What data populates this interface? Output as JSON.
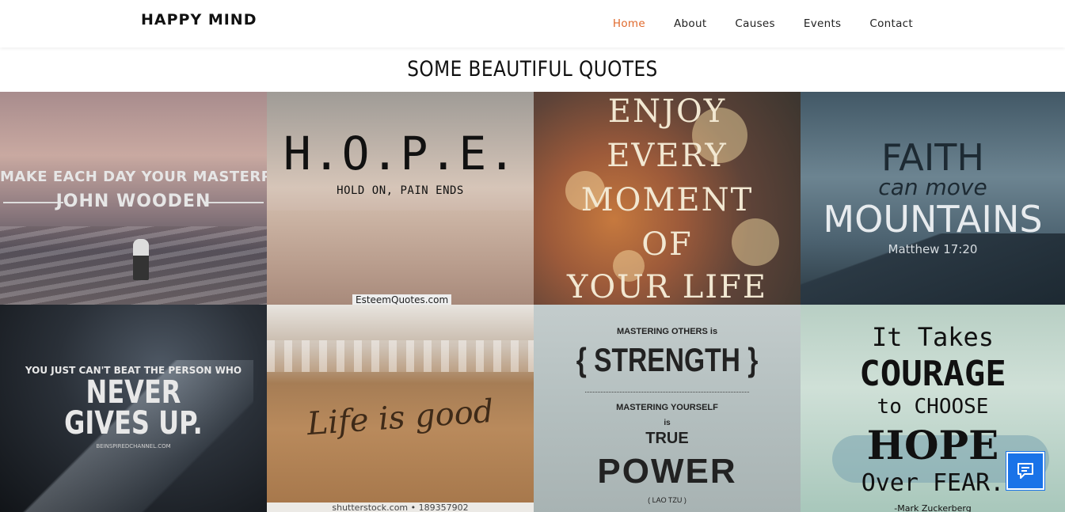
{
  "header": {
    "brand": "HAPPY MIND",
    "nav": [
      {
        "label": "Home",
        "active": true
      },
      {
        "label": "About",
        "active": false
      },
      {
        "label": "Causes",
        "active": false
      },
      {
        "label": "Events",
        "active": false
      },
      {
        "label": "Contact",
        "active": false
      }
    ],
    "accent_color": "#e0692c"
  },
  "main": {
    "title": "SOME BEAUTIFUL QUOTES",
    "quotes": [
      {
        "lines": [
          "MAKE EACH DAY YOUR MASTERPIECE",
          "JOHN WOODEN"
        ]
      },
      {
        "lines": [
          "H.O.P.E.",
          "HOLD ON, PAIN ENDS"
        ],
        "source": "EsteemQuotes.com"
      },
      {
        "lines": [
          "ENJOY",
          "EVERY",
          "MOMENT",
          "OF",
          "YOUR LIFE"
        ]
      },
      {
        "lines": [
          "FAITH",
          "can move",
          "MOUNTAINS",
          "Matthew 17:20"
        ]
      },
      {
        "lines": [
          "YOU JUST CAN'T BEAT THE PERSON WHO",
          "NEVER",
          "GIVES UP.",
          "BEINSPIREDCHANNEL.COM"
        ]
      },
      {
        "lines": [
          "Life is good"
        ],
        "source": "shutterstock.com • 189357902"
      },
      {
        "lines": [
          "MASTERING OTHERS is",
          "{ STRENGTH }",
          "MASTERING YOURSELF",
          "is",
          "TRUE",
          "POWER",
          "( LAO TZU )"
        ]
      },
      {
        "lines": [
          "It Takes",
          "COURAGE",
          "to CHOOSE",
          "HOPE",
          "Over FEAR.",
          "-Mark Zuckerberg"
        ]
      }
    ]
  },
  "chat": {
    "icon": "chat-icon",
    "color": "#1a73e8"
  }
}
